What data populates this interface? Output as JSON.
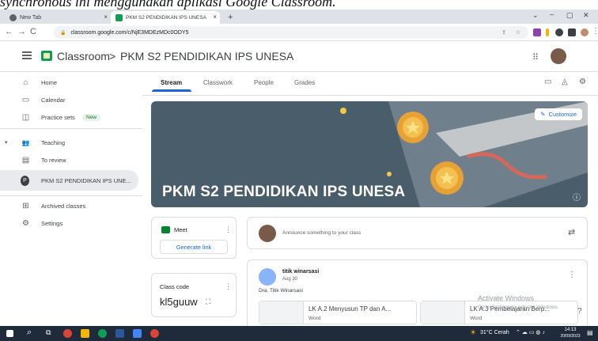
{
  "doc_text": "synchronous ini menggunakan aplikasi Google Classroom.",
  "browser": {
    "tabs": [
      {
        "label": "New Tab",
        "close": "×"
      },
      {
        "label": "PKM S2 PENDIDIKAN IPS UNESA",
        "close": "×"
      }
    ],
    "new_tab": "+",
    "window_buttons": [
      "⌄",
      "–",
      "▢",
      "✕"
    ],
    "url": "classroom.google.com/c/NjE3MDEzMDc0ODY5"
  },
  "header": {
    "app_name": "Classroom",
    "separator": ">",
    "class_name": "PKM S2 PENDIDIKAN IPS UNESA"
  },
  "sidebar": {
    "items": [
      {
        "label": "Home",
        "icon": "⌂"
      },
      {
        "label": "Calendar",
        "icon": "▭"
      },
      {
        "label": "Practice sets",
        "icon": "◫",
        "badge": "New"
      },
      {
        "label": "Teaching",
        "icon": "👥"
      },
      {
        "label": "To review",
        "icon": "▤"
      },
      {
        "label": "PKM S2 PENDIDIKAN IPS UNE...",
        "icon": "P"
      },
      {
        "label": "Archived classes",
        "icon": "⊞"
      },
      {
        "label": "Settings",
        "icon": "⚙"
      }
    ]
  },
  "class_tabs": [
    "Stream",
    "Classwork",
    "People",
    "Grades"
  ],
  "banner": {
    "title": "PKM S2 PENDIDIKAN IPS UNESA",
    "customize": "Customize"
  },
  "meet": {
    "label": "Meet",
    "generate": "Generate link"
  },
  "class_code": {
    "label": "Class code",
    "code": "kl5guuw"
  },
  "announce": {
    "placeholder": "Announce something to your class"
  },
  "post": {
    "author": "titik winarsasi",
    "date": "Aug 30",
    "body": "Dra. Titik Winarsasi",
    "attachments": [
      {
        "title": "LK A.2 Menyusun TP dan A...",
        "type": "Word"
      },
      {
        "title": "LK A.3 Pembelajaran Berp...",
        "type": "Word"
      }
    ]
  },
  "watermark": {
    "line1": "Activate Windows",
    "line2": "Go to Settings to activate Windows."
  },
  "taskbar": {
    "weather": "31°C Cerah",
    "time": "14:13",
    "date": "20/09/2023"
  },
  "colors": {
    "accent": "#1967d2",
    "banner": "#4a5d6a",
    "classroom_green": "#0f9d58",
    "taskbar": "#1f2b3a"
  }
}
